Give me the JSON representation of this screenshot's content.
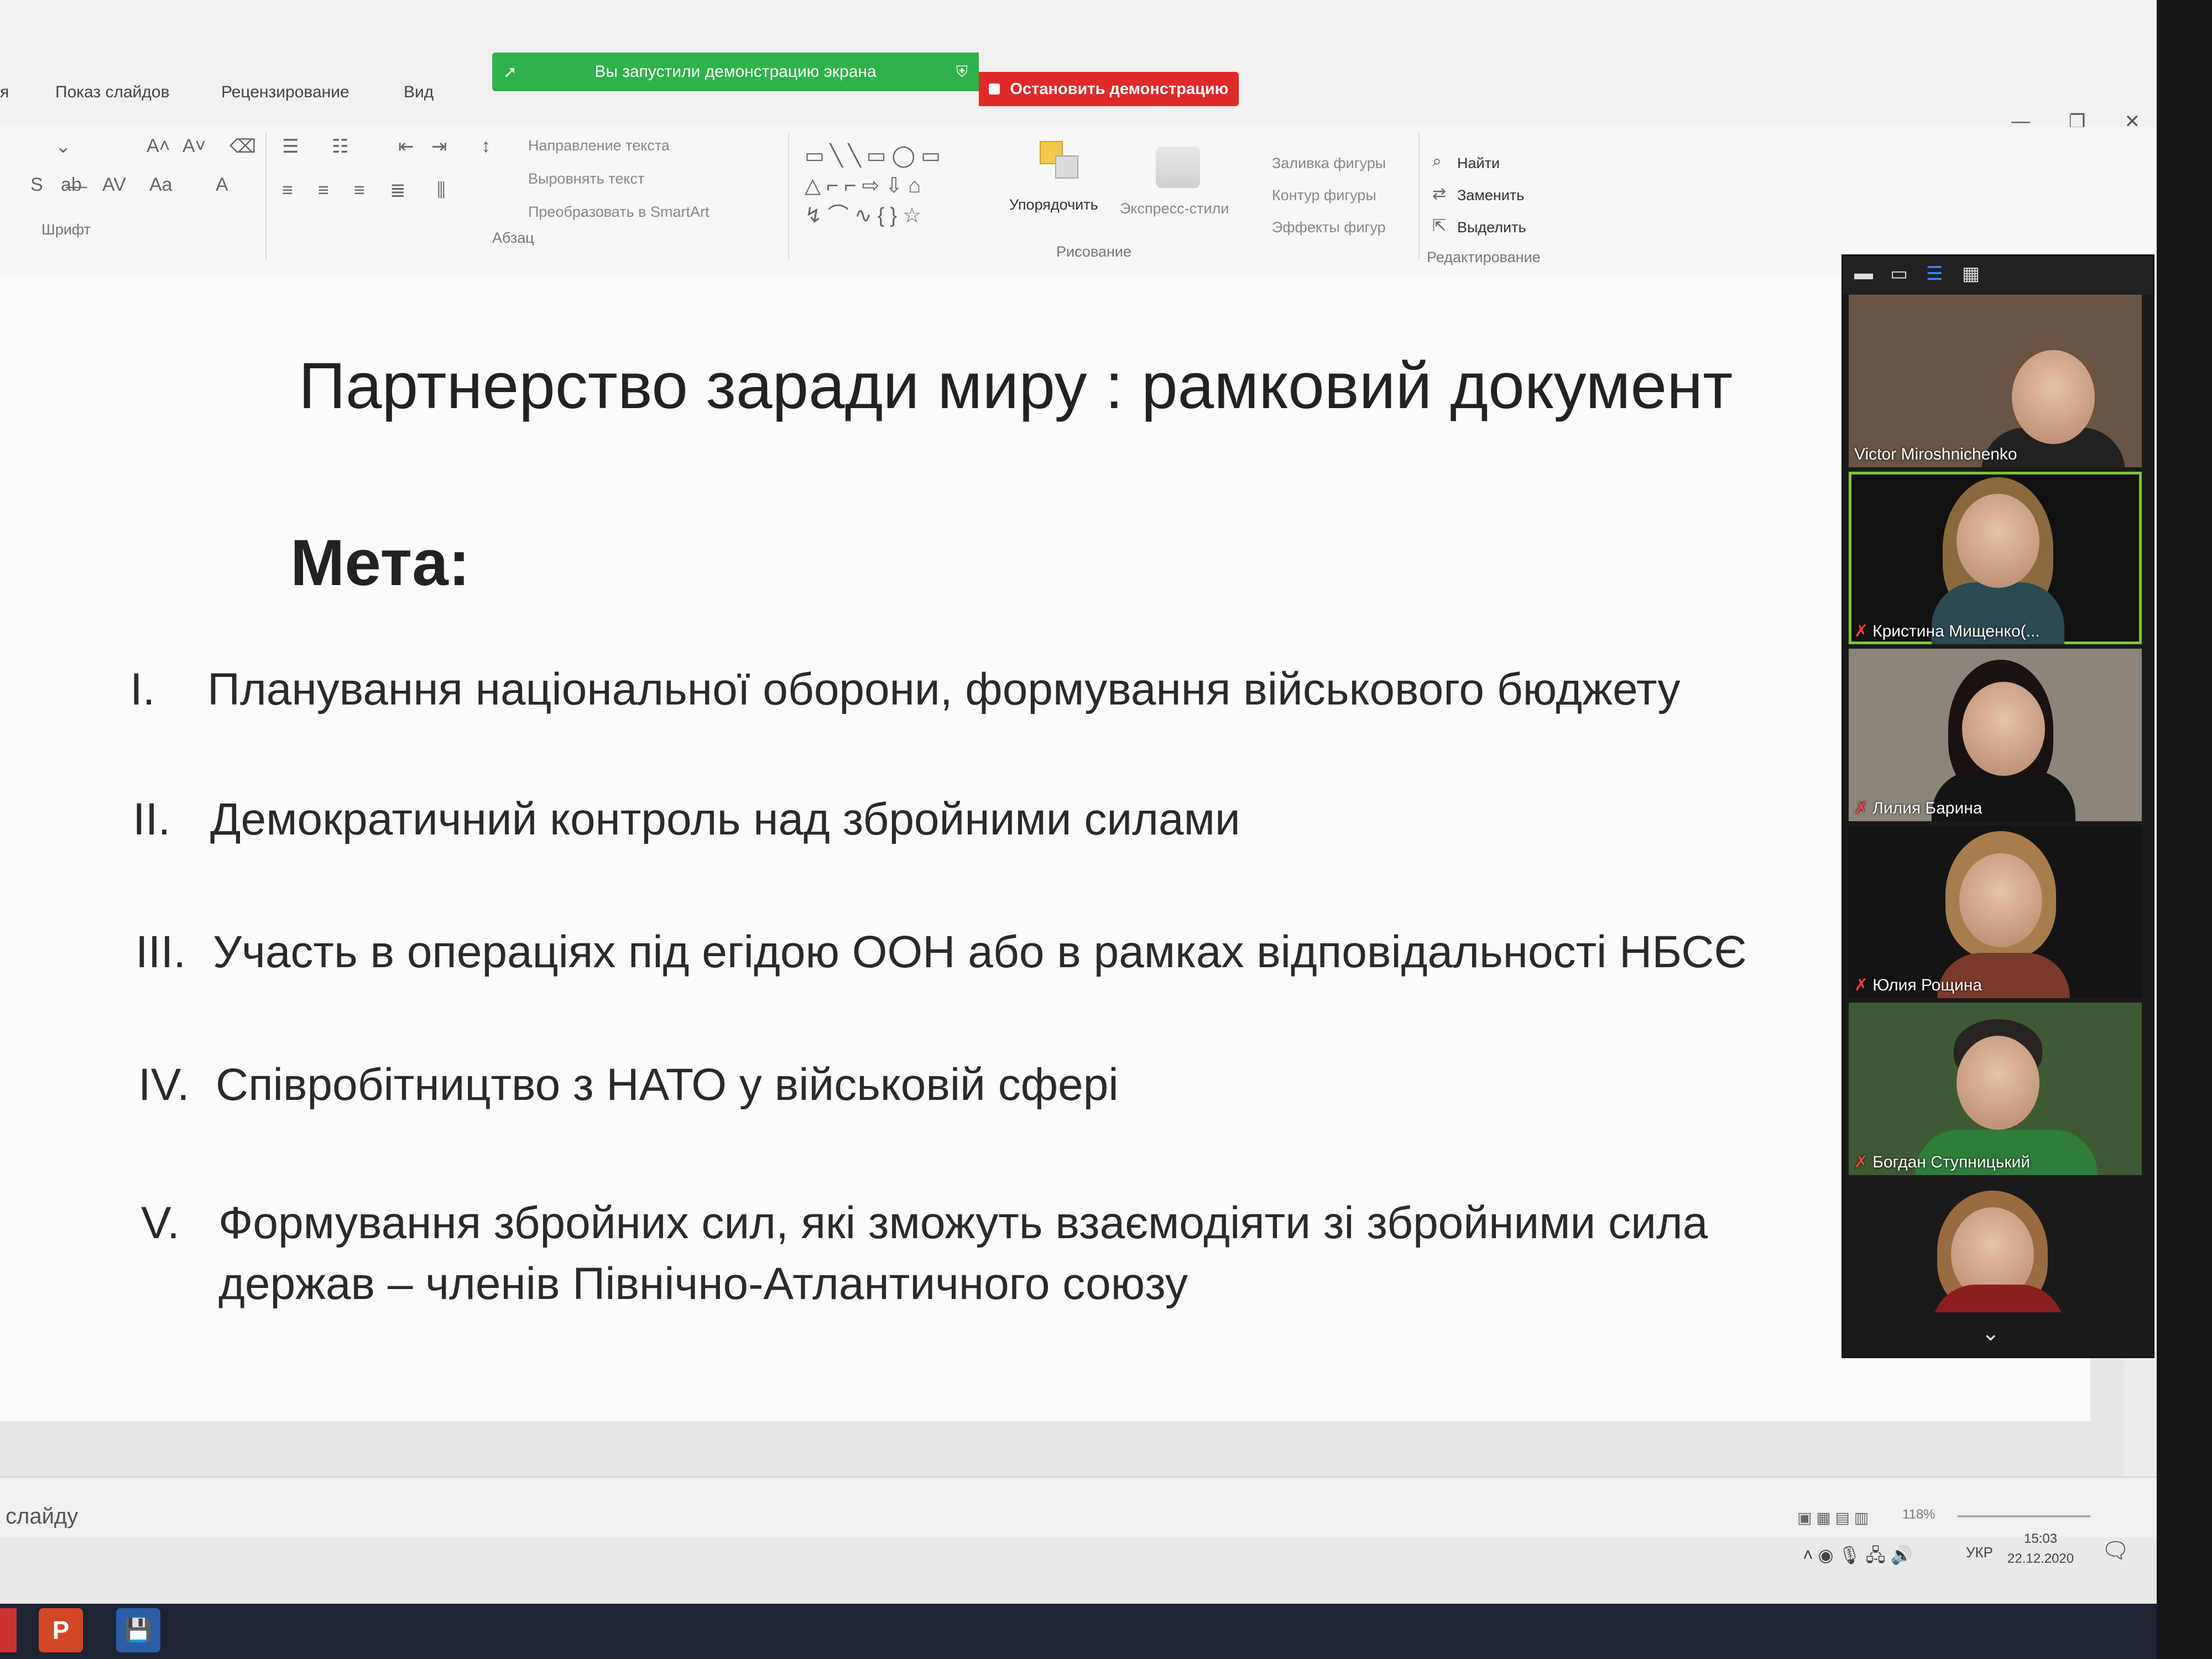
{
  "ribbon": {
    "tabs": [
      "я",
      "Показ слайдов",
      "Рецензирование",
      "Вид"
    ],
    "groups": {
      "font": "Шрифт",
      "paragraph": "Абзац",
      "drawing": "Рисование",
      "editing": "Редактирование"
    },
    "paragraph_cmds": [
      "Направление текста",
      "Выровнять текст",
      "Преобразовать в SmartArt"
    ],
    "arrange_label": "Упорядочить",
    "styles_label": "Экспресс-стили",
    "shape_cmds": [
      "Заливка фигуры",
      "Контур фигуры",
      "Эффекты фигур"
    ],
    "editing_cmds": [
      "Найти",
      "Заменить",
      "Выделить"
    ]
  },
  "share": {
    "banner": "Вы запустили демонстрацию экрана",
    "stop_label": "Остановить демонстрацию"
  },
  "slide": {
    "title": "Партнерство заради миру : рамковий документ",
    "subtitle": "Мета:",
    "items": [
      {
        "num": "I.",
        "text": "Планування національної оборони, формування військового бюджету"
      },
      {
        "num": "II.",
        "text": "Демократичний контроль над збройними силами"
      },
      {
        "num": "III.",
        "text": "Участь в операціях під егідою ООН або в рамках відповідальності НБСЄ"
      },
      {
        "num": "IV.",
        "text": "Співробітництво з НАТО у військовій сфері"
      },
      {
        "num": "V.",
        "text": "Формування збройних сил, які зможуть взаємодіяти зі збройними сила",
        "text2": "держав – членів Північно-Атлантичного союзу"
      }
    ]
  },
  "notes": {
    "text": "слайду"
  },
  "status": {
    "zoom": "118%",
    "lang": "УКР",
    "time": "15:03",
    "date": "22.12.2020"
  },
  "participants": [
    {
      "name": "Victor Miroshnichenko",
      "muted": false
    },
    {
      "name": "Кристина Мищенко(...",
      "muted": true
    },
    {
      "name": "Лилия Барина",
      "muted": true
    },
    {
      "name": "Юлия Рощина",
      "muted": true
    },
    {
      "name": "Богдан Ступницький",
      "muted": true
    },
    {
      "name": "",
      "muted": false
    }
  ],
  "colors": {
    "share_green": "#2eb34a",
    "stop_red": "#e02a2a",
    "active_speaker": "#7fc23b"
  }
}
